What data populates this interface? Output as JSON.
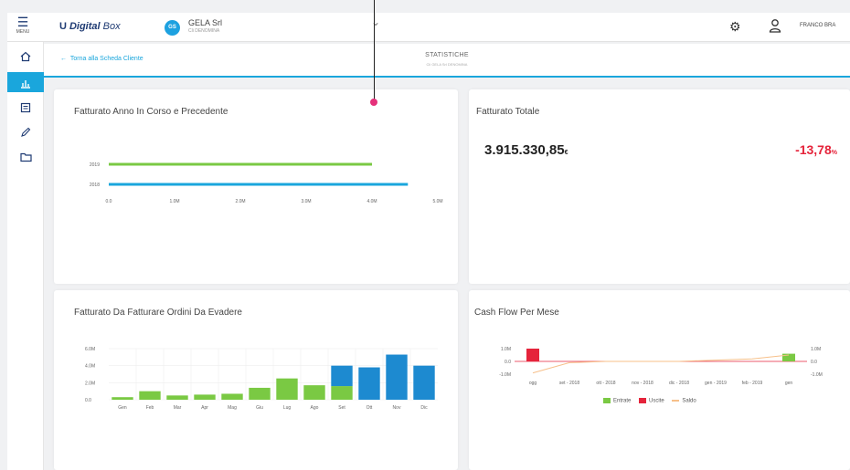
{
  "app": {
    "menu_icon": "hamburger-icon",
    "menu_label": "MENU",
    "logo_mark": "U",
    "logo_bold": "Digital",
    "logo_light": "Box"
  },
  "company": {
    "initials": "GS",
    "name": "GELA Srl",
    "subtitle": "Cli DENOMINA",
    "caret_icon": "chevron-down-icon"
  },
  "user": {
    "name": "FRANCO BRA",
    "settings_icon": "gear-icon",
    "user_icon": "user-icon"
  },
  "sidebar": {
    "items": [
      {
        "icon": "home-icon",
        "active": false
      },
      {
        "icon": "chart-icon",
        "active": true
      },
      {
        "icon": "document-icon",
        "active": false
      },
      {
        "icon": "pen-icon",
        "active": false
      },
      {
        "icon": "folder-icon",
        "active": false
      }
    ]
  },
  "subheader": {
    "back_label": "Torna alla Scheda Cliente",
    "title": "STATISTICHE",
    "subtitle": "Cli GELA Srl DENOMINA"
  },
  "cards": {
    "annual": {
      "title": "Fatturato Anno In Corso e Precedente"
    },
    "total": {
      "title": "Fatturato Totale",
      "value": "3.915.330,85",
      "currency": "€",
      "change": "-13,78",
      "change_unit": "%"
    },
    "orders": {
      "title": "Fatturato Da Fatturare Ordini Da Evadere"
    },
    "cashflow": {
      "title": "Cash Flow Per Mese",
      "legend": [
        {
          "label": "Entrate",
          "color": "#7ac943"
        },
        {
          "label": "Uscite",
          "color": "#e5243b"
        },
        {
          "label": "Saldo",
          "color": "#f7c08a"
        }
      ]
    }
  },
  "colors": {
    "accent": "#1aa6dc",
    "green": "#7ac943",
    "blue": "#1d8ad0",
    "red": "#e5243b",
    "orange": "#f7c08a"
  },
  "chart_data": [
    {
      "type": "bar",
      "orientation": "horizontal",
      "categories": [
        "2019",
        "2018"
      ],
      "values": [
        4.4,
        5.0
      ],
      "colors": [
        "#7ac943",
        "#1aa6dc"
      ],
      "xlim": [
        0,
        5.5
      ],
      "xticks": [
        "0.0",
        "1.0M",
        "2.0M",
        "3.0M",
        "4.0M",
        "5.0M"
      ]
    },
    {
      "type": "bar",
      "stacked": true,
      "categories": [
        "Gen",
        "Feb",
        "Mar",
        "Apr",
        "Mag",
        "Giu",
        "Lug",
        "Ago",
        "Set",
        "Ott",
        "Nov",
        "Dic"
      ],
      "series": [
        {
          "color": "#7ac943",
          "values": [
            0.3,
            1.0,
            0.5,
            0.6,
            0.7,
            1.4,
            2.5,
            1.7,
            1.6,
            0,
            0,
            0
          ]
        },
        {
          "color": "#1d8ad0",
          "values": [
            0,
            0,
            0,
            0,
            0,
            0,
            0,
            0,
            2.4,
            3.8,
            5.3,
            4.0
          ]
        }
      ],
      "ylim": [
        0,
        6.0
      ],
      "yticks": [
        "0.0",
        "2.0M",
        "4.0M",
        "6.0M"
      ]
    },
    {
      "type": "bar",
      "categories": [
        "ogg",
        "set - 2018",
        "ott - 2018",
        "nov - 2018",
        "dic - 2018",
        "gen - 2019",
        "feb - 2019",
        "gen"
      ],
      "series": [
        {
          "name": "Entrate",
          "color": "#7ac943",
          "values": [
            0.0,
            0.0,
            0.0,
            0.0,
            0.0,
            0.0,
            0.0,
            0.6
          ]
        },
        {
          "name": "Uscite",
          "color": "#e5243b",
          "values": [
            1.0,
            0.0,
            0.0,
            0.0,
            0.0,
            0.0,
            0.0,
            0.0
          ]
        },
        {
          "name": "Saldo",
          "color": "#f7c08a",
          "values": [
            -0.9,
            -0.1,
            0.0,
            0.0,
            0.0,
            0.1,
            0.2,
            0.5
          ]
        }
      ],
      "ylim": [
        -1.0,
        1.0
      ],
      "yticks_left": [
        "1.0M",
        "0.0",
        "-1.0M"
      ],
      "yticks_right": [
        "1.0M",
        "0.0",
        "-1.0M"
      ]
    }
  ]
}
